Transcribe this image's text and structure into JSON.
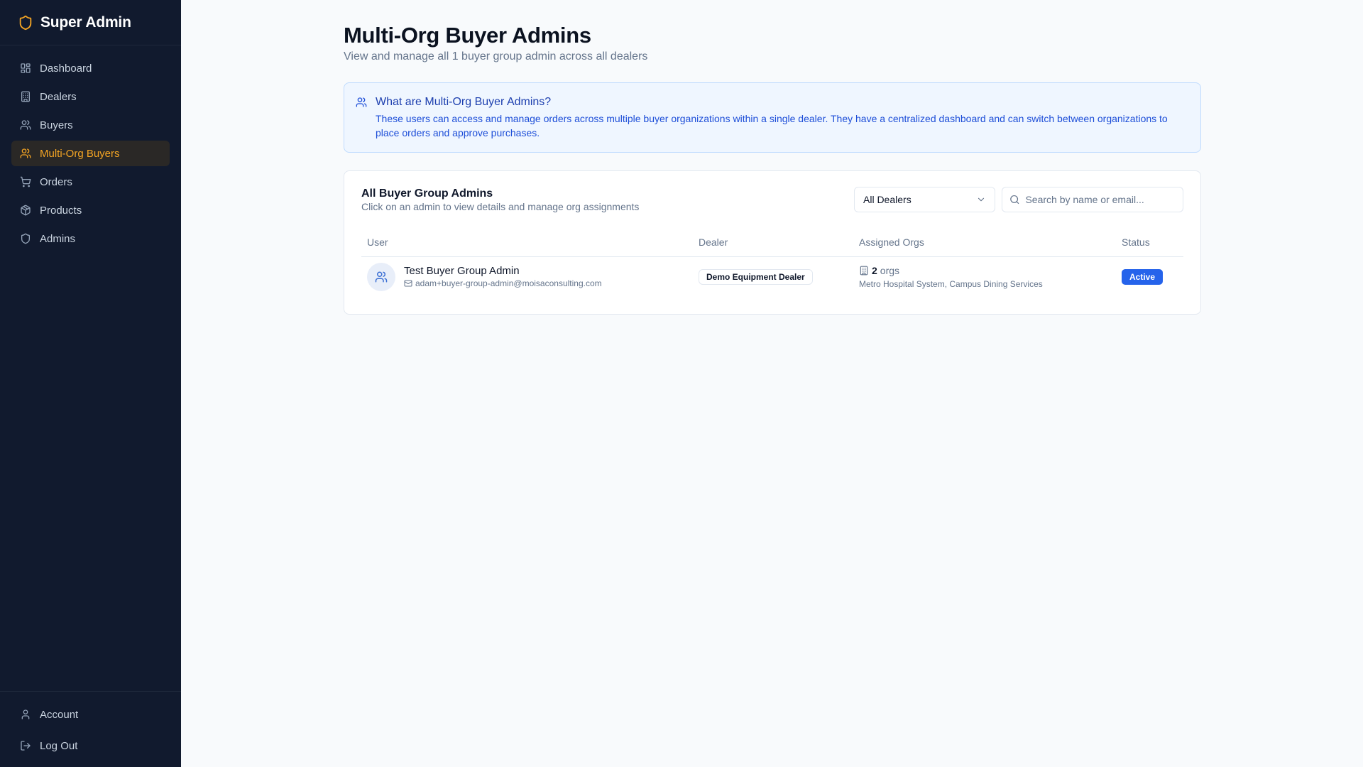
{
  "app": {
    "brand": "Super Admin",
    "brand_icon": "shield-icon",
    "accent_color": "#f5a524"
  },
  "sidebar": {
    "items": [
      {
        "label": "Dashboard",
        "icon": "grid-icon"
      },
      {
        "label": "Dealers",
        "icon": "building-icon"
      },
      {
        "label": "Buyers",
        "icon": "users-icon"
      },
      {
        "label": "Multi-Org Buyers",
        "icon": "users-icon",
        "active": true
      },
      {
        "label": "Orders",
        "icon": "cart-icon"
      },
      {
        "label": "Products",
        "icon": "package-icon"
      },
      {
        "label": "Admins",
        "icon": "shield-icon"
      }
    ],
    "bottom": [
      {
        "label": "Account",
        "icon": "user-icon"
      },
      {
        "label": "Log Out",
        "icon": "logout-icon"
      }
    ]
  },
  "page": {
    "title": "Multi-Org Buyer Admins",
    "subtitle": "View and manage all 1 buyer group admin across all dealers"
  },
  "info": {
    "title": "What are Multi-Org Buyer Admins?",
    "text": "These users can access and manage orders across multiple buyer organizations within a single dealer. They have a centralized dashboard and can switch between organizations to place orders and approve purchases."
  },
  "card": {
    "title": "All Buyer Group Admins",
    "subtitle": "Click on an admin to view details and manage org assignments",
    "dealer_filter": "All Dealers",
    "search_placeholder": "Search by name or email...",
    "columns": [
      "User",
      "Dealer",
      "Assigned Orgs",
      "Status"
    ],
    "rows": [
      {
        "name": "Test Buyer Group Admin",
        "email": "adam+buyer-group-admin@moisaconsulting.com",
        "dealer": "Demo Equipment Dealer",
        "org_count": "2",
        "org_unit": "orgs",
        "org_names": "Metro Hospital System, Campus Dining Services",
        "status": "Active",
        "status_color": "#2563eb"
      }
    ]
  }
}
